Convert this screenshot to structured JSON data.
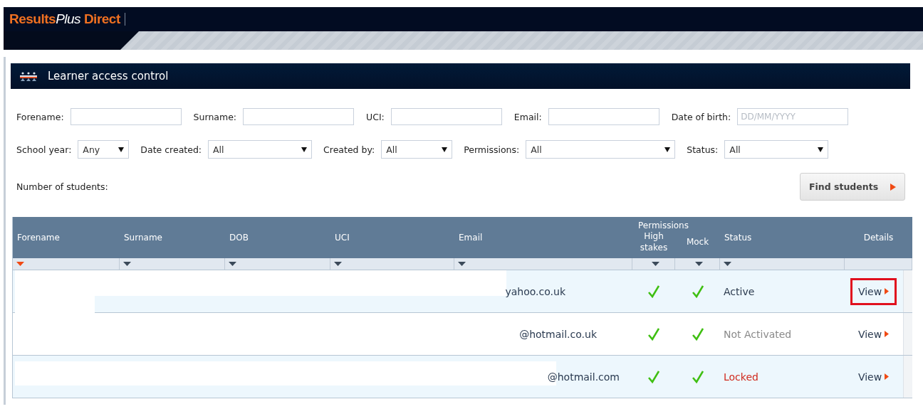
{
  "brand": {
    "results": "Results",
    "plus": "Plus",
    "direct": "Direct"
  },
  "panel": {
    "title": "Learner access control"
  },
  "filters": [
    {
      "label": "Forename:",
      "kind": "text"
    },
    {
      "label": "Surname:",
      "kind": "text"
    },
    {
      "label": "UCI:",
      "kind": "text"
    },
    {
      "label": "Email:",
      "kind": "text"
    },
    {
      "label": "Date of birth:",
      "kind": "text",
      "placeholder": "DD/MM/YYYY"
    }
  ],
  "selects": [
    {
      "label": "School year:",
      "value": "Any"
    },
    {
      "label": "Date created:",
      "value": "All"
    },
    {
      "label": "Created by:",
      "value": "All"
    },
    {
      "label": "Permissions:",
      "value": "All"
    },
    {
      "label": "Status:",
      "value": "All"
    }
  ],
  "count_label": "Number of students:",
  "find_button": "Find students",
  "table": {
    "permissions_group": "Permissions",
    "columns": [
      {
        "label": "Forename",
        "kind": "sortable",
        "selected": true
      },
      {
        "label": "Surname",
        "kind": "sortable",
        "selected": false
      },
      {
        "label": "DOB",
        "kind": "sortable",
        "selected": false
      },
      {
        "label": "UCI",
        "kind": "sortable",
        "selected": false
      },
      {
        "label": "Email",
        "kind": "sortable",
        "selected": false
      },
      {
        "label": "High stakes",
        "kind": "sortable",
        "selected": false
      },
      {
        "label": "Mock",
        "kind": "sortable",
        "selected": false
      },
      {
        "label": "Status",
        "kind": "sortable",
        "selected": false
      },
      {
        "label": "Details",
        "kind": "plain",
        "selected": false
      }
    ],
    "rows": [
      {
        "email": "yahoo.co.uk",
        "high_stakes": true,
        "mock": true,
        "status": "Active",
        "color": "#2b3a4e",
        "view": "View",
        "highlighted": true
      },
      {
        "email": "@hotmail.co.uk",
        "high_stakes": true,
        "mock": true,
        "status": "Not Activated",
        "color": "#8a8a8a",
        "view": "View",
        "highlighted": false
      },
      {
        "email": "@hotmail.com",
        "high_stakes": true,
        "mock": true,
        "status": "Locked",
        "color": "#d02a1e",
        "view": "View",
        "highlighted": false
      }
    ]
  }
}
